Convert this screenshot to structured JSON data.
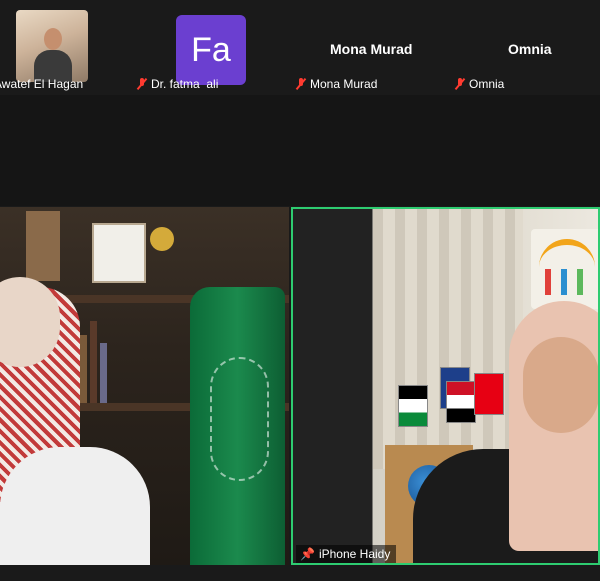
{
  "participants_strip": {
    "tiles": [
      {
        "label": "Awatef El Hagan",
        "muted": false,
        "kind": "video"
      },
      {
        "label": "Dr. fatma  ali",
        "muted": true,
        "kind": "avatar",
        "avatar_initials": "Fa",
        "avatar_color": "#6b3fd0"
      },
      {
        "label": "Mona Murad",
        "muted": true,
        "kind": "name",
        "display_name": "Mona Murad"
      },
      {
        "label": "Omnia",
        "muted": true,
        "kind": "name",
        "display_name": "Omnia"
      }
    ]
  },
  "main_videos": {
    "left": {
      "active_speaker": false
    },
    "right": {
      "label": "iPhone Haidy",
      "pinned": true,
      "active_speaker": true,
      "highlight_color": "#2ecc71"
    }
  },
  "icons": {
    "muted": "mic-off-icon",
    "pinned": "pin-icon"
  }
}
